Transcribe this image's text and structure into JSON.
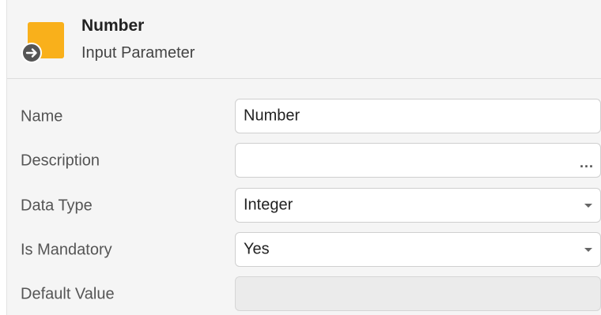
{
  "header": {
    "title": "Number",
    "subtitle": "Input Parameter",
    "icon": "input-parameter-icon",
    "accent_color": "#f9b01b"
  },
  "properties": {
    "name": {
      "label": "Name",
      "value": "Number"
    },
    "description": {
      "label": "Description",
      "value": "",
      "button": "..."
    },
    "data_type": {
      "label": "Data Type",
      "value": "Integer"
    },
    "is_mandatory": {
      "label": "Is Mandatory",
      "value": "Yes"
    },
    "default_value": {
      "label": "Default Value",
      "value": ""
    }
  }
}
